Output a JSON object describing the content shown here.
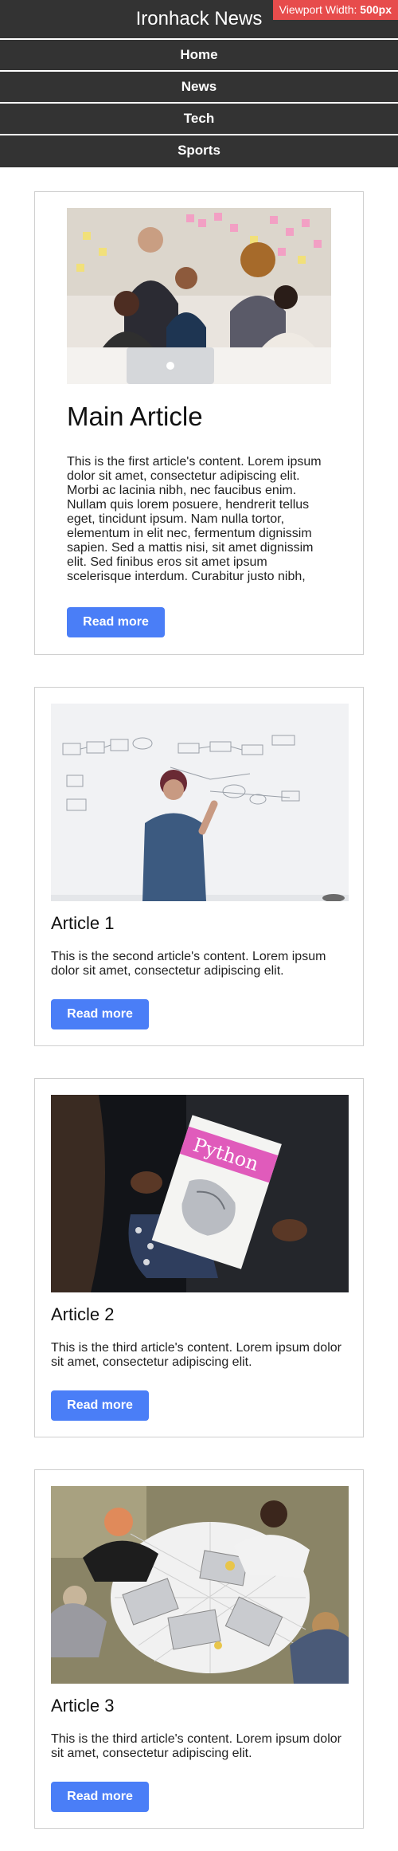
{
  "header": {
    "title": "Ironhack News",
    "viewport_badge_prefix": "Viewport Width: ",
    "viewport_badge_value": "500px",
    "nav": [
      "Home",
      "News",
      "Tech",
      "Sports"
    ]
  },
  "colors": {
    "header_bg": "#333333",
    "badge_bg": "#e74c4c",
    "button_bg": "#4a7ef7",
    "card_border": "#cfcfcf"
  },
  "main_article": {
    "title": "Main Article",
    "body": "This is the first article's content. Lorem ipsum dolor sit amet, consectetur adipiscing elit. Morbi ac lacinia nibh, nec faucibus enim. Nullam quis lorem posuere, hendrerit tellus eget, tincidunt ipsum. Nam nulla tortor, elementum in elit nec, fermentum dignissim sapien. Sed a mattis nisi, sit amet dignissim elit. Sed finibus eros sit amet ipsum scelerisque interdum. Curabitur justo nibh,",
    "button": "Read more"
  },
  "articles": [
    {
      "title": "Article 1",
      "body": "This is the second article's content. Lorem ipsum dolor sit amet, consectetur adipiscing elit.",
      "button": "Read more"
    },
    {
      "title": "Article 2",
      "body": "This is the third article's content. Lorem ipsum dolor sit amet, consectetur adipiscing elit.",
      "button": "Read more"
    },
    {
      "title": "Article 3",
      "body": "This is the third article's content. Lorem ipsum dolor sit amet, consectetur adipiscing elit.",
      "button": "Read more"
    }
  ]
}
